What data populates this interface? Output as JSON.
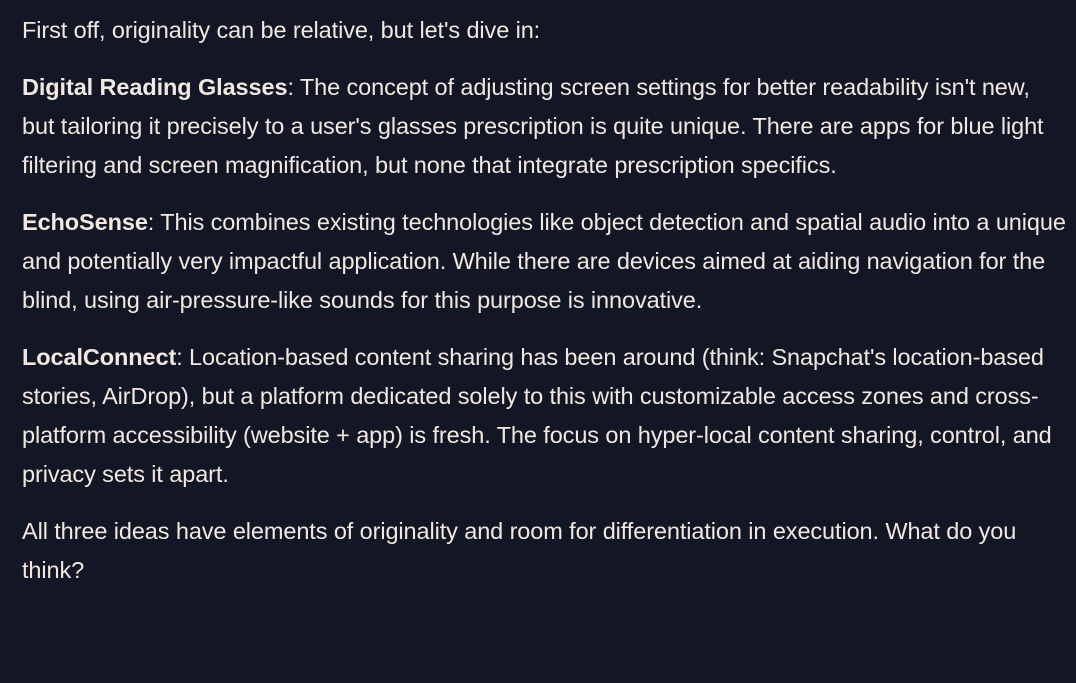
{
  "message": {
    "intro": "First off, originality can be relative, but let's dive in:",
    "items": [
      {
        "term": "Digital Reading Glasses",
        "text": ": The concept of adjusting screen settings for better readability isn't new, but tailoring it precisely to a user's glasses prescription is quite unique. There are apps for blue light filtering and screen magnification, but none that integrate prescription specifics."
      },
      {
        "term": "EchoSense",
        "text": ": This combines existing technologies like object detection and spatial audio into a unique and potentially very impactful application. While there are devices aimed at aiding navigation for the blind, using air-pressure-like sounds for this purpose is innovative."
      },
      {
        "term": "LocalConnect",
        "text": ": Location-based content sharing has been around (think: Snapchat's location-based stories, AirDrop), but a platform dedicated solely to this with customizable access zones and cross-platform accessibility (website + app) is fresh. The focus on hyper-local content sharing, control, and privacy sets it apart."
      }
    ],
    "closing": "All three ideas have elements of originality and room for differentiation in execution. What do you think?"
  },
  "colors": {
    "background": "#131625",
    "text": "#f1e9e1"
  }
}
